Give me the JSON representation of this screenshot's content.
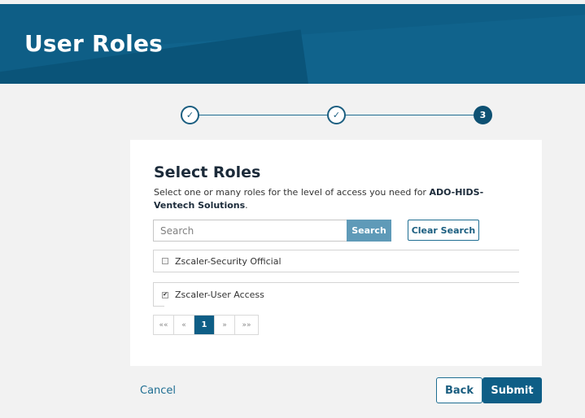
{
  "header": {
    "title": "User Roles"
  },
  "stepper": {
    "steps": [
      {
        "state": "done",
        "glyph": "✓"
      },
      {
        "state": "done",
        "glyph": "✓"
      },
      {
        "state": "active",
        "glyph": "3"
      }
    ]
  },
  "card": {
    "title": "Select Roles",
    "description_prefix": "Select one or many roles for the level of access you need for ",
    "org_name": "ADO-HIDS-Ventech Solutions",
    "description_suffix": "."
  },
  "search": {
    "placeholder": "Search",
    "value": "",
    "button_label": "Search",
    "clear_label": "Clear Search"
  },
  "roles": [
    {
      "label": "Zscaler-Security Official",
      "checked": false
    },
    {
      "label": "Zscaler-User Access",
      "checked": true
    }
  ],
  "pagination": {
    "first": "««",
    "prev": "«",
    "current": "1",
    "next": "»",
    "last": "»»"
  },
  "footer": {
    "cancel_label": "Cancel",
    "back_label": "Back",
    "submit_label": "Submit"
  },
  "colors": {
    "primary": "#0e5e86",
    "search_button": "#5f9ab8",
    "link": "#1f6e92"
  }
}
